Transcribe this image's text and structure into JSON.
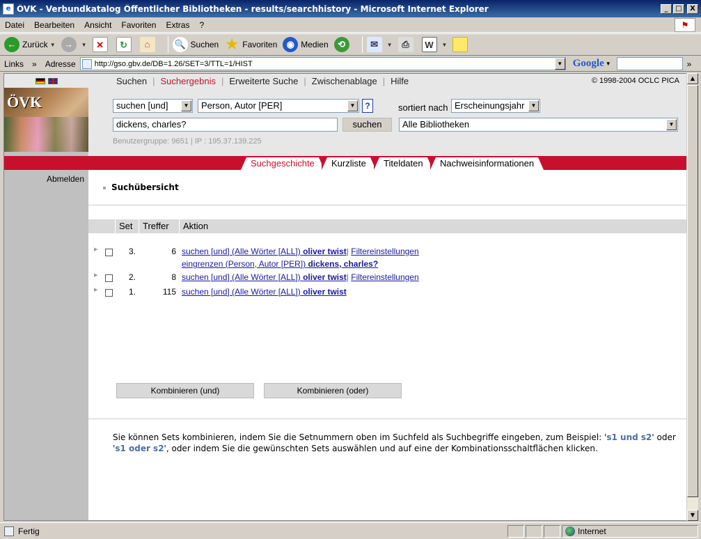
{
  "window": {
    "title": "ÖVK - Verbundkatalog Öffentlicher Bibliotheken - results/searchhistory - Microsoft Internet Explorer",
    "controls": [
      "_",
      "□",
      "X"
    ]
  },
  "menubar": [
    "Datei",
    "Bearbeiten",
    "Ansicht",
    "Favoriten",
    "Extras",
    "?"
  ],
  "toolbar": {
    "back": "Zurück",
    "search": "Suchen",
    "favorites": "Favoriten",
    "media": "Medien"
  },
  "addressbar": {
    "links_label": "Links",
    "address_label": "Adresse",
    "url": "http://gso.gbv.de/DB=1.26/SET=3/TTL=1/HIST",
    "google_label": "Google"
  },
  "page": {
    "topnav": {
      "items": [
        "Suchen",
        "Suchergebnis",
        "Erweiterte Suche",
        "Zwischenablage",
        "Hilfe"
      ],
      "active_index": 1,
      "copyright": "© 1998-2004 OCLC PICA"
    },
    "logo_text": "ÖVK",
    "search": {
      "operator": "suchen [und]",
      "field": "Person, Autor [PER]",
      "help": "?",
      "sort_label": "sortiert nach",
      "sort_value": "Erscheinungsjahr",
      "query": "dickens, charles?",
      "button": "suchen",
      "library": "Alle Bibliotheken",
      "usergroup": "Benutzergruppe: 9651 | IP : 195.37.139.225"
    },
    "tabs": [
      "Suchgeschichte",
      "Kurzliste",
      "Titeldaten",
      "Nachweisinformationen"
    ],
    "logout": "Abmelden",
    "section_title": "Suchübersicht",
    "table": {
      "headers": [
        "Set",
        "Treffer",
        "Aktion"
      ],
      "rows": [
        {
          "set": "3.",
          "hits": "6",
          "action_prefix": "suchen [und] (Alle Wörter [ALL])",
          "action_term": "oliver twist",
          "filter": "Filtereinstellungen",
          "refine_prefix": "eingrenzen (Person, Autor [PER])",
          "refine_term": "dickens, charles?"
        },
        {
          "set": "2.",
          "hits": "8",
          "action_prefix": "suchen [und] (Alle Wörter [ALL])",
          "action_term": "oliver twist",
          "filter": "Filtereinstellungen"
        },
        {
          "set": "1.",
          "hits": "115",
          "action_prefix": "suchen [und] (Alle Wörter [ALL])",
          "action_term": "oliver twist"
        }
      ]
    },
    "combine_and": "Kombinieren (und)",
    "combine_or": "Kombinieren (oder)",
    "help": {
      "part1": "Sie können Sets kombinieren, indem Sie die Setnummern oben im Suchfeld als Suchbegriffe eingeben, zum Beispiel: '",
      "code1": "s1 und s2",
      "part2": "' oder '",
      "code2": "s1 oder s2",
      "part3": "', oder indem Sie die gewünschten Sets auswählen und auf eine der Kombinationsschaltflächen klicken."
    }
  },
  "statusbar": {
    "status": "Fertig",
    "zone": "Internet"
  },
  "colors": {
    "accent_red": "#c8102e",
    "link_blue": "#1a1a99",
    "code_blue": "#4a6fa5"
  }
}
